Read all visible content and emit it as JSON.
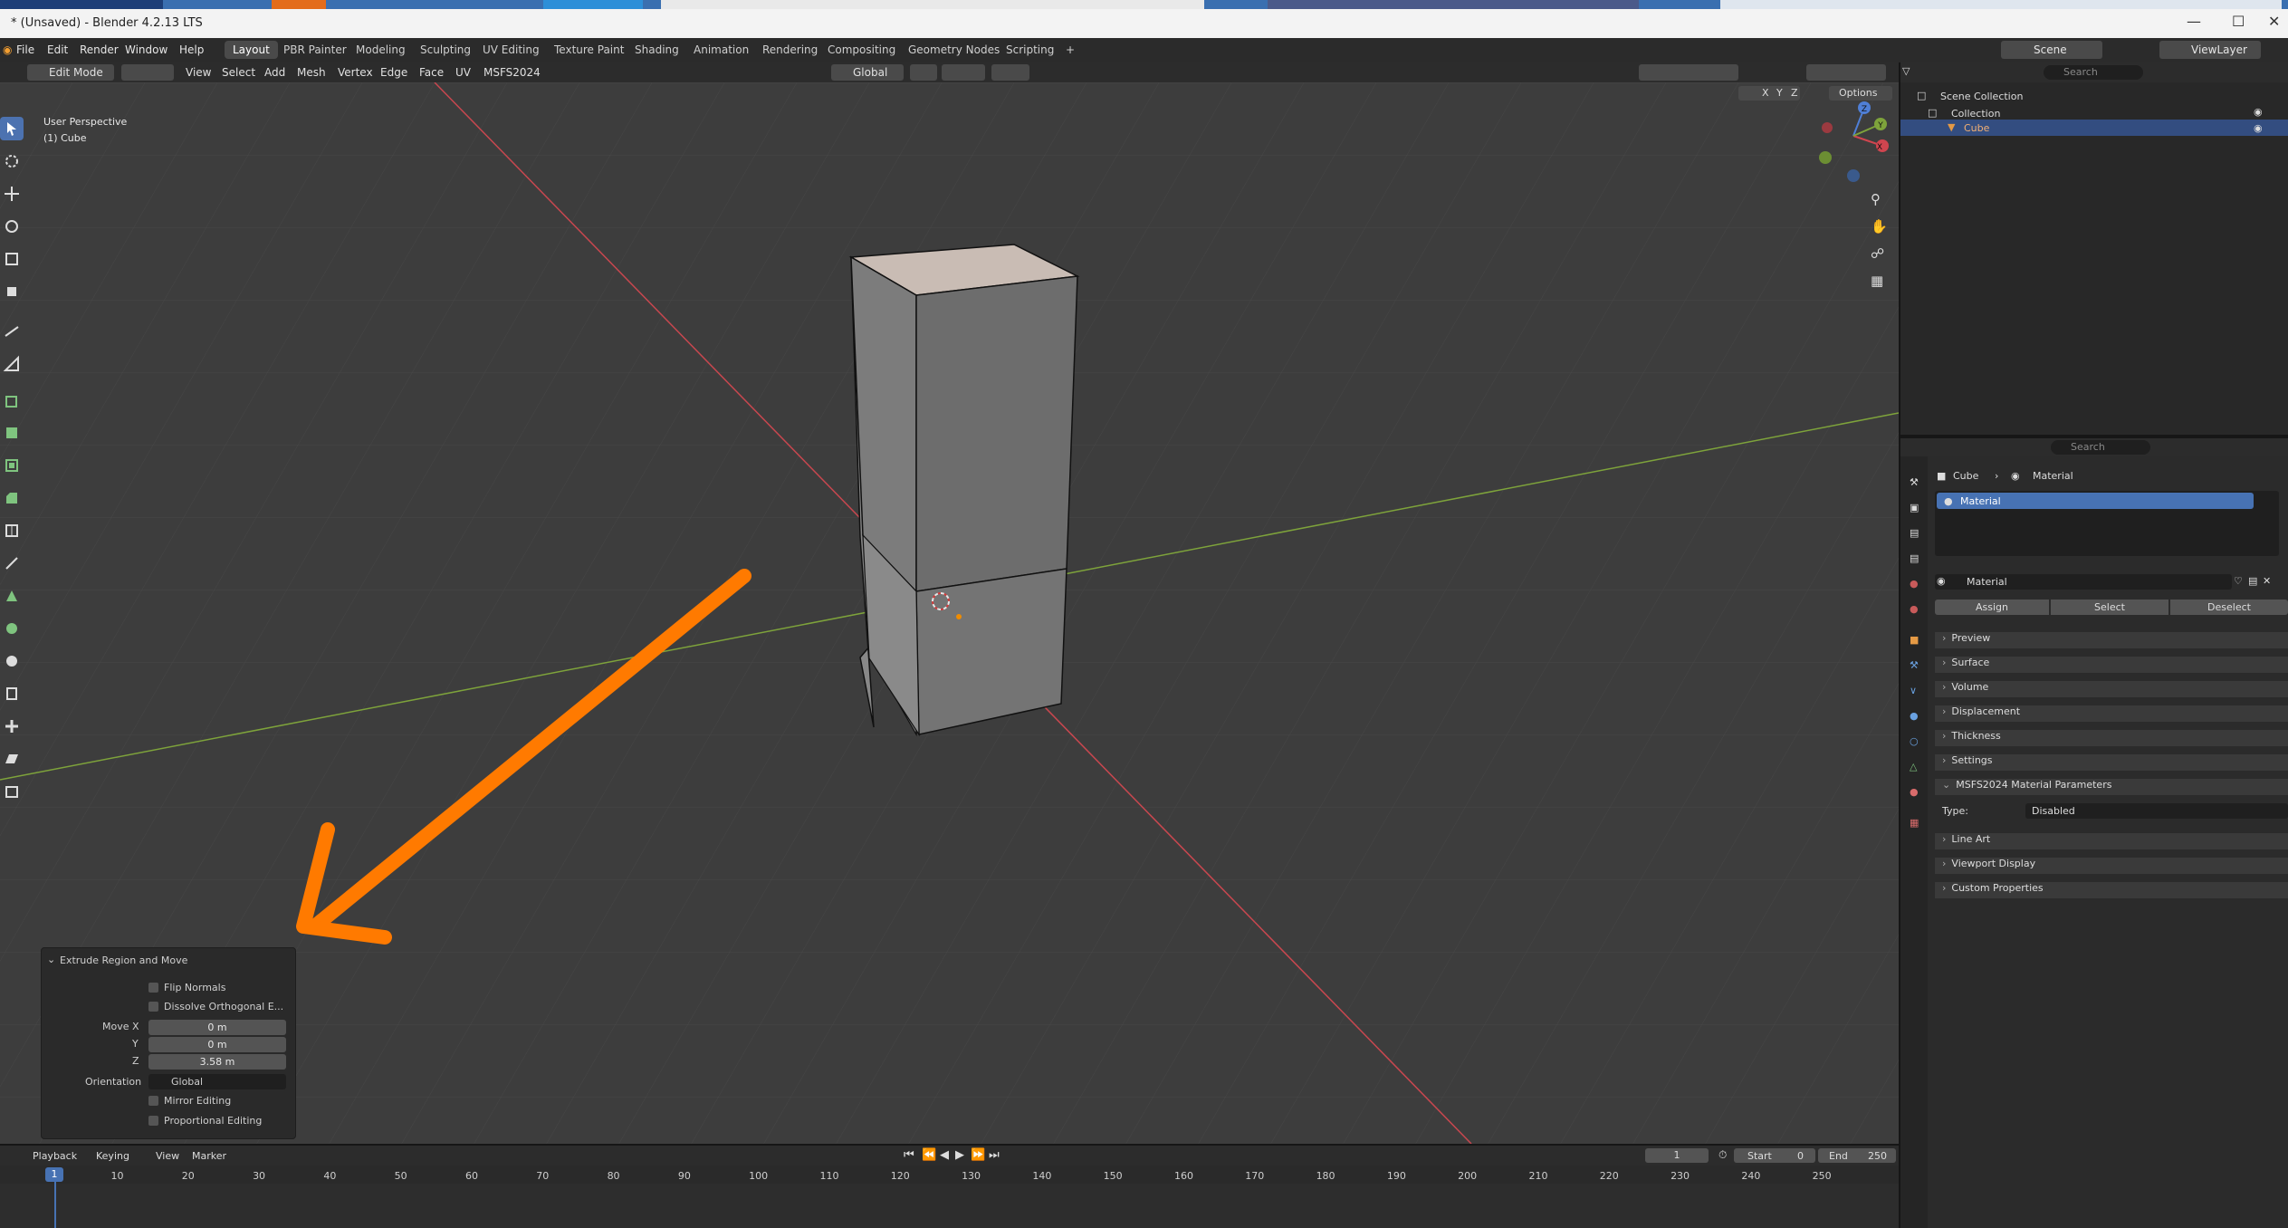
{
  "window": {
    "title": "* (Unsaved) - Blender 4.2.13 LTS",
    "title_prefix_icon": "blender-logo-icon"
  },
  "menus": [
    "File",
    "Edit",
    "Render",
    "Window",
    "Help"
  ],
  "workspaces": {
    "tabs": [
      "Layout",
      "PBR Painter",
      "Modeling",
      "Sculpting",
      "UV Editing",
      "Texture Paint",
      "Shading",
      "Animation",
      "Rendering",
      "Compositing",
      "Geometry Nodes",
      "Scripting"
    ],
    "active": "Layout",
    "add": "+"
  },
  "scene_selector": {
    "scene": "Scene",
    "view_layer": "ViewLayer"
  },
  "viewport_header": {
    "mode": "Edit Mode",
    "menus": [
      "View",
      "Select",
      "Add",
      "Mesh",
      "Vertex",
      "Edge",
      "Face",
      "UV",
      "MSFS2024"
    ],
    "transform_orientation": "Global",
    "axes": [
      "X",
      "Y",
      "Z"
    ],
    "options_label": "Options"
  },
  "viewport": {
    "view_name": "User Perspective",
    "object_name": "(1) Cube",
    "gizmo_axes": [
      "X",
      "Y",
      "Z"
    ],
    "colors": {
      "background": "#3d3d3d",
      "x_axis": "#c8474f",
      "y_axis": "#7ea33b",
      "arrow": "#ff7a00"
    }
  },
  "operator_panel": {
    "title": "Extrude Region and Move",
    "flip_normals": "Flip Normals",
    "dissolve": "Dissolve Orthogonal E...",
    "move_x_label": "Move X",
    "move_y_label": "Y",
    "move_z_label": "Z",
    "move_x": "0 m",
    "move_y": "0 m",
    "move_z": "3.58 m",
    "orientation_label": "Orientation",
    "orientation": "Global",
    "mirror": "Mirror Editing",
    "proportional": "Proportional Editing"
  },
  "outliner": {
    "search_placeholder": "Search",
    "scene_collection": "Scene Collection",
    "collection": "Collection",
    "object": "Cube"
  },
  "properties": {
    "search_placeholder": "Search",
    "breadcrumb": [
      "Cube",
      "Material"
    ],
    "slot": "Material",
    "material_name": "Material",
    "buttons": [
      "Assign",
      "Select",
      "Deselect"
    ],
    "sections": [
      "Preview",
      "Surface",
      "Volume",
      "Displacement",
      "Thickness",
      "Settings",
      "MSFS2024 Material Parameters"
    ],
    "msfs_type_label": "Type:",
    "msfs_type_value": "Disabled",
    "sections_after": [
      "Line Art",
      "Viewport Display",
      "Custom Properties"
    ]
  },
  "timeline": {
    "menus": [
      "Playback",
      "Keying",
      "View",
      "Marker"
    ],
    "current_frame": "1",
    "start_label": "Start",
    "start": "0",
    "end_label": "End",
    "end": "250",
    "ticks": [
      "10",
      "20",
      "30",
      "40",
      "50",
      "60",
      "70",
      "80",
      "90",
      "100",
      "110",
      "120",
      "130",
      "140",
      "150",
      "160",
      "170",
      "180",
      "190",
      "200",
      "210",
      "220",
      "230",
      "240",
      "250"
    ],
    "playhead_label": "1"
  }
}
